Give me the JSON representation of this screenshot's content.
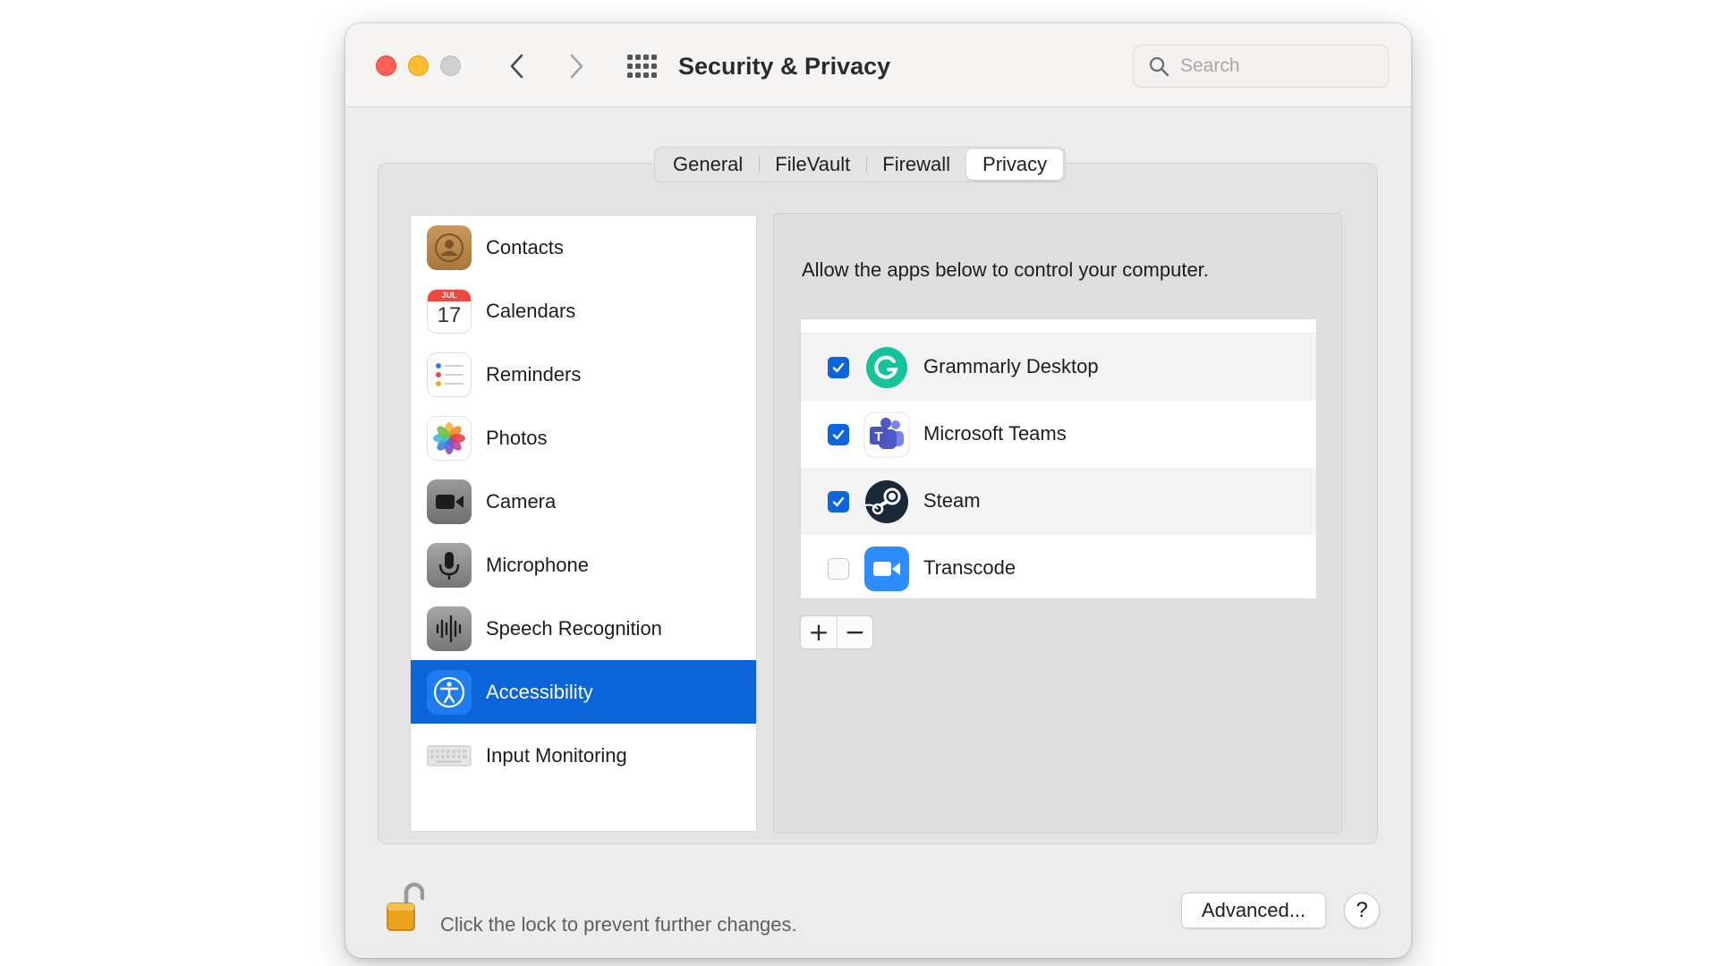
{
  "window": {
    "title": "Security & Privacy"
  },
  "search": {
    "placeholder": "Search",
    "value": ""
  },
  "tabs": [
    {
      "label": "General",
      "active": false
    },
    {
      "label": "FileVault",
      "active": false
    },
    {
      "label": "Firewall",
      "active": false
    },
    {
      "label": "Privacy",
      "active": true
    }
  ],
  "sidebar": {
    "items": [
      {
        "label": "Contacts",
        "icon": "contacts-icon"
      },
      {
        "label": "Calendars",
        "icon": "calendar-icon",
        "month": "JUL",
        "day": "17"
      },
      {
        "label": "Reminders",
        "icon": "reminders-icon"
      },
      {
        "label": "Photos",
        "icon": "photos-icon"
      },
      {
        "label": "Camera",
        "icon": "camera-icon"
      },
      {
        "label": "Microphone",
        "icon": "microphone-icon"
      },
      {
        "label": "Speech Recognition",
        "icon": "waveform-icon"
      },
      {
        "label": "Accessibility",
        "icon": "accessibility-icon",
        "selected": true
      },
      {
        "label": "Input Monitoring",
        "icon": "keyboard-icon"
      }
    ]
  },
  "main": {
    "description": "Allow the apps below to control your computer.",
    "apps": [
      {
        "name": "Grammarly Desktop",
        "checked": true,
        "icon": "grammarly-icon"
      },
      {
        "name": "Microsoft Teams",
        "checked": true,
        "icon": "teams-icon"
      },
      {
        "name": "Steam",
        "checked": true,
        "icon": "steam-icon"
      },
      {
        "name": "Transcode",
        "checked": false,
        "icon": "video-camera-icon"
      }
    ],
    "add_label": "+",
    "remove_label": "−"
  },
  "footer": {
    "lock_text": "Click the lock to prevent further changes.",
    "advanced_label": "Advanced...",
    "help_label": "?"
  },
  "colors": {
    "selection": "#0b64d8",
    "checkbox_on": "#0b66dd",
    "traffic_close": "#fe5f57",
    "traffic_min": "#febc2e",
    "traffic_max": "#d0d0d0"
  }
}
